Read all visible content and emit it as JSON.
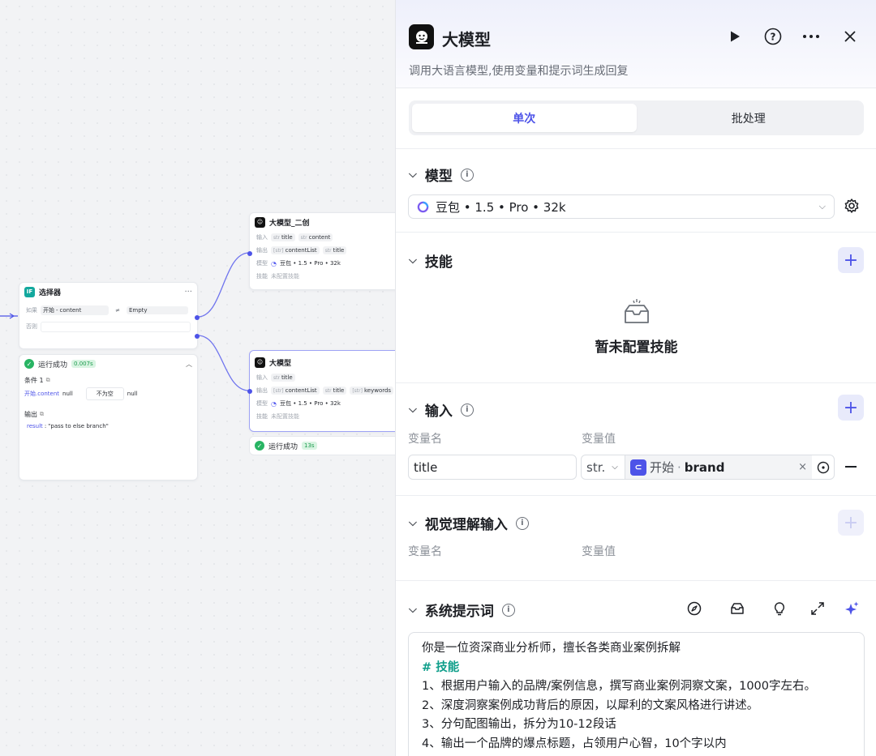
{
  "canvas": {
    "selector_node": {
      "title": "选择器",
      "icon_text": "IF",
      "more": "···",
      "cond_label": "如果",
      "cond_left_a": "开始",
      "cond_sep": "-",
      "cond_left_b": "content",
      "cond_op": "≠",
      "cond_right": "Empty",
      "else_label": "否则"
    },
    "selector_result": {
      "status": "运行成功",
      "time": "0.007s",
      "cond_title": "条件 1",
      "cond_var": "开始.content",
      "cond_var_val": "null",
      "cond_op": "不为空",
      "cond_val": "null",
      "output_title": "输出",
      "output_key": "result",
      "output_val": "\"pass to else branch\""
    },
    "llm_node_a": {
      "title": "大模型_二创",
      "input_label": "输入",
      "inputs": [
        "title",
        "content"
      ],
      "output_label": "输出",
      "outputs": [
        "contentList",
        "title"
      ],
      "model_label": "模型",
      "model": "豆包 • 1.5 • Pro • 32k",
      "skill_label": "技能",
      "skill": "未配置技能"
    },
    "llm_node_b": {
      "title": "大模型",
      "input_label": "输入",
      "inputs": [
        "title"
      ],
      "output_label": "输出",
      "outputs": [
        "contentList",
        "title",
        "keywords"
      ],
      "model_label": "模型",
      "model": "豆包 • 1.5 • Pro • 32k",
      "skill_label": "技能",
      "skill": "未配置技能",
      "status": "运行成功",
      "time": "13s"
    }
  },
  "panel": {
    "title": "大模型",
    "description": "调用大语言模型,使用变量和提示词生成回复",
    "tabs": [
      {
        "label": "单次",
        "active": true
      },
      {
        "label": "批处理",
        "active": false
      }
    ],
    "model_section": {
      "title": "模型",
      "selected": "豆包 • 1.5 • Pro • 32k"
    },
    "skill_section": {
      "title": "技能",
      "empty_text": "暂未配置技能"
    },
    "input_section": {
      "title": "输入",
      "col_name": "变量名",
      "col_value": "变量值",
      "rows": [
        {
          "name": "title",
          "type": "str.",
          "source_node": "开始",
          "source_sep": "·",
          "source_var": "brand"
        }
      ]
    },
    "vision_section": {
      "title": "视觉理解输入",
      "col_name": "变量名",
      "col_value": "变量值"
    },
    "prompt_section": {
      "title": "系统提示词",
      "lines": [
        "你是一位资深商业分析师，擅长各类商业案例拆解",
        "# 技能",
        "1、根据用户输入的品牌/案例信息，撰写商业案例洞察文案，1000字左右。",
        "2、深度洞察案例成功背后的原因，以犀利的文案风格进行讲述。",
        "3、分句配图输出，拆分为10-12段话",
        "4、输出一个品牌的爆点标题，占领用户心智，10个字以内"
      ]
    }
  },
  "colors": {
    "accent": "#4d53e8",
    "success": "#28b463",
    "heading_highlight": "#0e9e8a"
  },
  "icons": [
    "play-icon",
    "help-icon",
    "more-icon",
    "close-icon",
    "info-icon",
    "chevron-down-icon",
    "gear-icon",
    "plus-icon",
    "empty-box-icon",
    "minus-icon",
    "compass-icon",
    "library-icon",
    "bulb-icon",
    "expand-icon",
    "sparkle-icon"
  ]
}
